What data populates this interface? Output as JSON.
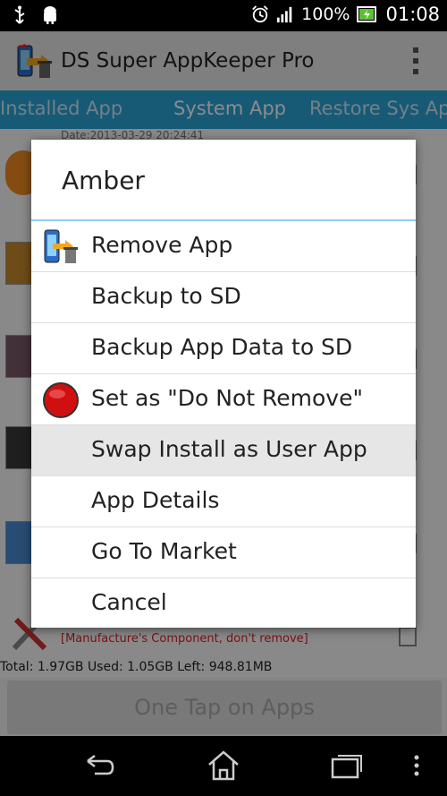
{
  "status_bar": {
    "battery_percent": "100%",
    "time": "01:08",
    "icons": [
      "usb-icon",
      "android-icon",
      "alarm-icon",
      "signal-icon",
      "battery-icon"
    ]
  },
  "header": {
    "app_title": "DS Super AppKeeper Pro",
    "overflow_icon": "overflow-menu-icon"
  },
  "tabs": [
    {
      "label": "Installed App",
      "active": false
    },
    {
      "label": "System App",
      "active": true
    },
    {
      "label": "Restore Sys App",
      "active": false
    }
  ],
  "list": {
    "first_row_date": "Date:2013-03-29 20:24:41",
    "warning_text": "[Manufacture's Component, don't remove]"
  },
  "footer": {
    "storage": "Total: 1.97GB Used: 1.05GB Left: 948.81MB",
    "one_tap_label": "One Tap on Apps"
  },
  "dialog": {
    "title": "Amber",
    "items": [
      {
        "label": "Remove App",
        "icon": "phone-trash-icon"
      },
      {
        "label": "Backup to SD",
        "icon": ""
      },
      {
        "label": "Backup App Data to SD",
        "icon": ""
      },
      {
        "label": "Set as \"Do Not Remove\"",
        "icon": "red-dot-icon"
      },
      {
        "label": "Swap Install as User App",
        "icon": "",
        "highlighted": true
      },
      {
        "label": "App Details",
        "icon": ""
      },
      {
        "label": "Go To Market",
        "icon": ""
      },
      {
        "label": "Cancel",
        "icon": ""
      }
    ]
  },
  "nav_bar": {
    "buttons": [
      "back-icon",
      "home-icon",
      "recents-icon",
      "menu-icon"
    ]
  },
  "colors": {
    "tab_bar": "#2aa4d8",
    "dialog_divider": "#8fd0ee",
    "status_bar": "#000000"
  }
}
